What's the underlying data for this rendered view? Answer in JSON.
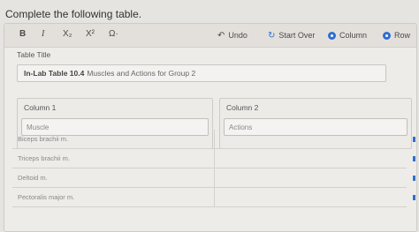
{
  "prompt": "Complete the following table.",
  "toolbar": {
    "bold": "B",
    "italic": "I",
    "subscript": "X₂",
    "superscript": "X²",
    "special_chars": "Ω·",
    "undo": "Undo",
    "start_over": "Start Over",
    "column": "Column",
    "row": "Row"
  },
  "table_title": {
    "label": "Table Title",
    "bold_part": "In-Lab Table 10.4",
    "rest": "Muscles and Actions for Group 2"
  },
  "columns": [
    {
      "header": "Column 1",
      "value": "Muscle"
    },
    {
      "header": "Column 2",
      "value": "Actions"
    }
  ],
  "rows": [
    {
      "c1": "Biceps brachii m.",
      "c2": ""
    },
    {
      "c1": "Triceps brachii m.",
      "c2": ""
    },
    {
      "c1": "Deltoid m.",
      "c2": ""
    },
    {
      "c1": "Pectoralis major m.",
      "c2": ""
    }
  ],
  "colors": {
    "accent": "#2d6fd1"
  }
}
